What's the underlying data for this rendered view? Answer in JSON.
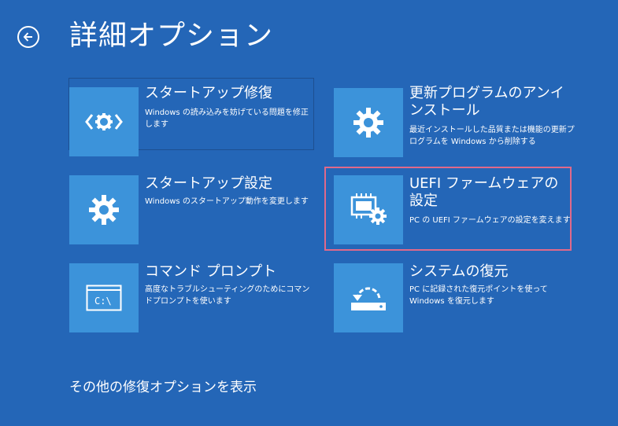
{
  "header": {
    "title": "詳細オプション"
  },
  "tiles": [
    {
      "title": "スタートアップ修復",
      "description": "Windows の読み込みを妨げている問題を修正します",
      "icon": "code-gear-icon"
    },
    {
      "title": "更新プログラムのアンインストール",
      "description": "最近インストールした品質または機能の更新プログラムを Windows から削除する",
      "icon": "gear-icon"
    },
    {
      "title": "スタートアップ設定",
      "description": "Windows のスタートアップ動作を変更します",
      "icon": "gear-icon"
    },
    {
      "title": "UEFI ファームウェアの設定",
      "description": "PC の UEFI ファームウェアの設定を変えます",
      "icon": "chip-gear-icon"
    },
    {
      "title": "コマンド プロンプト",
      "description": "高度なトラブルシューティングのためにコマンドプロンプトを使います",
      "icon": "command-prompt-icon",
      "prompt_text": "C:\\"
    },
    {
      "title": "システムの復元",
      "description": "PC に記録された復元ポイントを使って Windows を復元します",
      "icon": "system-restore-icon"
    }
  ],
  "footer": {
    "more_options": "その他の修復オプションを表示"
  },
  "colors": {
    "background": "#2466b7",
    "tile_icon_bg": "#3c93da",
    "highlight": "#e0698a"
  }
}
